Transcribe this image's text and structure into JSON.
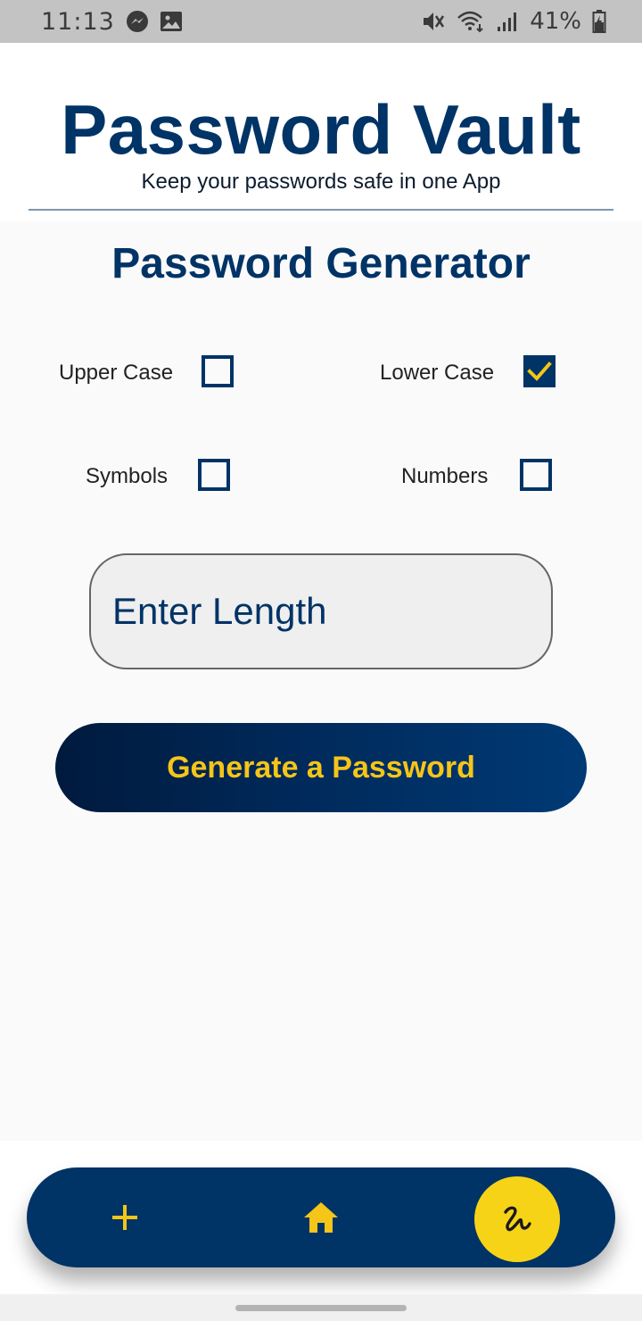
{
  "status_bar": {
    "time": "11:13",
    "battery": "41%",
    "icons": [
      "messenger-icon",
      "gallery-icon",
      "mute-icon",
      "wifi-icon",
      "signal-icon",
      "battery-icon"
    ]
  },
  "header": {
    "title": "Password Vault",
    "subtitle": "Keep your passwords safe in one App"
  },
  "generator": {
    "title": "Password Generator",
    "options": {
      "upper": {
        "label": "Upper Case",
        "checked": false
      },
      "lower": {
        "label": "Lower Case",
        "checked": true
      },
      "symbols": {
        "label": "Symbols",
        "checked": false
      },
      "numbers": {
        "label": "Numbers",
        "checked": false
      }
    },
    "length_input": {
      "placeholder": "Enter Length",
      "value": ""
    },
    "generate_label": "Generate a Password"
  },
  "bottom_nav": {
    "items": [
      "add-icon",
      "home-icon",
      "generate-icon"
    ],
    "active": "generate-icon"
  },
  "colors": {
    "primary": "#003366",
    "accent": "#F5C518",
    "active_nav": "#F7D317",
    "input_background": "#EFEFEF"
  }
}
